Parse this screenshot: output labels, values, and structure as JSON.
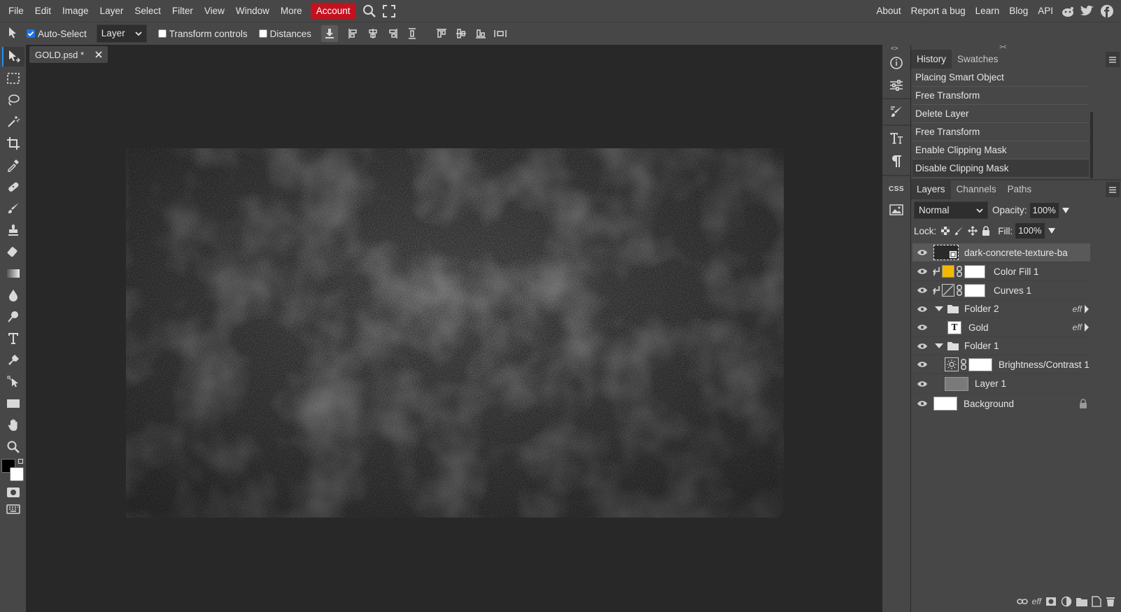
{
  "menubar": {
    "items": [
      "File",
      "Edit",
      "Image",
      "Layer",
      "Select",
      "Filter",
      "View",
      "Window",
      "More"
    ],
    "account": "Account",
    "right_items": [
      "About",
      "Report a bug",
      "Learn",
      "Blog",
      "API"
    ]
  },
  "options": {
    "auto_select": "Auto-Select",
    "layer_mode": "Layer",
    "transform_controls": "Transform controls",
    "distances": "Distances"
  },
  "document": {
    "tab_title": "GOLD.psd *"
  },
  "history": {
    "tabs": [
      "History",
      "Swatches"
    ],
    "items": [
      "Placing Smart Object",
      "Free Transform",
      "Delete Layer",
      "Free Transform",
      "Enable Clipping Mask",
      "Disable Clipping Mask"
    ]
  },
  "layers_panel": {
    "tabs": [
      "Layers",
      "Channels",
      "Paths"
    ],
    "blend_mode": "Normal",
    "opacity_label": "Opacity:",
    "opacity": "100%",
    "lock_label": "Lock:",
    "fill_label": "Fill:",
    "fill": "100%",
    "layers": [
      {
        "name": "dark-concrete-texture-ba",
        "kind": "smart",
        "selected": true
      },
      {
        "name": "Color Fill 1",
        "kind": "fill",
        "color": "#f5b800"
      },
      {
        "name": "Curves 1",
        "kind": "curves"
      },
      {
        "name": "Folder 2",
        "kind": "folder",
        "fx": "eff"
      },
      {
        "name": "Gold",
        "kind": "text",
        "fx": "eff"
      },
      {
        "name": "Folder 1",
        "kind": "folder"
      },
      {
        "name": "Brightness/Contrast 1",
        "kind": "brightness"
      },
      {
        "name": "Layer 1",
        "kind": "pixel"
      },
      {
        "name": "Background",
        "kind": "background"
      }
    ],
    "text_thumb": "T",
    "footer_fx": "eff"
  },
  "sidecol": {
    "css_label": "CSS"
  },
  "colors": {
    "accent": "#1f8fff",
    "account": "#c3121f",
    "chrome": "#474747",
    "workspace": "#282828"
  }
}
